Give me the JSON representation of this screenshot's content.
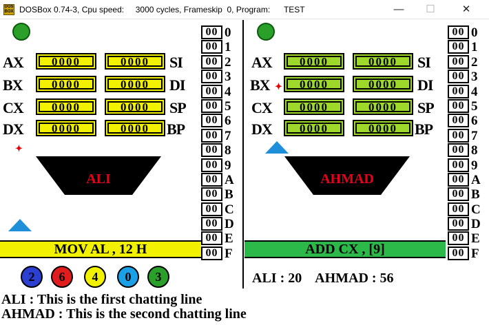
{
  "window": {
    "title": "DOSBox 0.74-3, Cpu speed:     3000 cycles, Frameskip  0, Program:      TEST",
    "icon_text": "DOS BOX",
    "minimize": "—",
    "maximize": "☐",
    "close": "✕"
  },
  "left_player": {
    "name": "ALI",
    "registers": {
      "left": [
        {
          "label": "AX",
          "value": "0000"
        },
        {
          "label": "BX",
          "value": "0000"
        },
        {
          "label": "CX",
          "value": "0000"
        },
        {
          "label": "DX",
          "value": "0000"
        }
      ],
      "right": [
        {
          "label": "SI",
          "value": "0000"
        },
        {
          "label": "DI",
          "value": "0000"
        },
        {
          "label": "SP",
          "value": "0000"
        },
        {
          "label": "BP",
          "value": "0000"
        }
      ]
    },
    "command": "MOV AL , 12 H",
    "balls": [
      {
        "value": "2",
        "color": "#2b3fd0"
      },
      {
        "value": "6",
        "color": "#e01c1c"
      },
      {
        "value": "4",
        "color": "#f2f200"
      },
      {
        "value": "0",
        "color": "#1aa0e6"
      },
      {
        "value": "3",
        "color": "#2aa02a"
      }
    ]
  },
  "right_player": {
    "name": "AHMAD",
    "registers": {
      "left": [
        {
          "label": "AX",
          "value": "0000"
        },
        {
          "label": "BX",
          "value": "0000"
        },
        {
          "label": "CX",
          "value": "0000"
        },
        {
          "label": "DX",
          "value": "0000"
        }
      ],
      "right": [
        {
          "label": "SI",
          "value": "0000"
        },
        {
          "label": "DI",
          "value": "0000"
        },
        {
          "label": "SP",
          "value": "0000"
        },
        {
          "label": "BP",
          "value": "0000"
        }
      ]
    },
    "command": "ADD CX , [9]"
  },
  "memory_left": [
    {
      "value": "00",
      "index": "0"
    },
    {
      "value": "00",
      "index": "1"
    },
    {
      "value": "00",
      "index": "2"
    },
    {
      "value": "00",
      "index": "3"
    },
    {
      "value": "00",
      "index": "4"
    },
    {
      "value": "00",
      "index": "5"
    },
    {
      "value": "00",
      "index": "6"
    },
    {
      "value": "00",
      "index": "7"
    },
    {
      "value": "00",
      "index": "8"
    },
    {
      "value": "00",
      "index": "9"
    },
    {
      "value": "00",
      "index": "A"
    },
    {
      "value": "00",
      "index": "B"
    },
    {
      "value": "00",
      "index": "C"
    },
    {
      "value": "00",
      "index": "D"
    },
    {
      "value": "00",
      "index": "E"
    },
    {
      "value": "00",
      "index": "F"
    }
  ],
  "memory_right": [
    {
      "value": "00",
      "index": "0"
    },
    {
      "value": "00",
      "index": "1"
    },
    {
      "value": "00",
      "index": "2"
    },
    {
      "value": "00",
      "index": "3"
    },
    {
      "value": "00",
      "index": "4"
    },
    {
      "value": "00",
      "index": "5"
    },
    {
      "value": "00",
      "index": "6"
    },
    {
      "value": "00",
      "index": "7"
    },
    {
      "value": "00",
      "index": "8"
    },
    {
      "value": "00",
      "index": "9"
    },
    {
      "value": "00",
      "index": "A"
    },
    {
      "value": "00",
      "index": "B"
    },
    {
      "value": "00",
      "index": "C"
    },
    {
      "value": "00",
      "index": "D"
    },
    {
      "value": "00",
      "index": "E"
    },
    {
      "value": "00",
      "index": "F"
    }
  ],
  "score": {
    "text": "ALI : 20    AHMAD : 56"
  },
  "chat": [
    "ALI : This is the first chatting line",
    "AHMAD : This is the second chatting line"
  ],
  "colors": {
    "register_yellow": "#f2f200",
    "register_green": "#9ed82a",
    "command_yellow": "#f2f200",
    "command_green": "#2db84a",
    "ship": "#000000",
    "ship_name": "#e8001a",
    "gun": "#1e8fd8",
    "led": "#2aa02a"
  }
}
